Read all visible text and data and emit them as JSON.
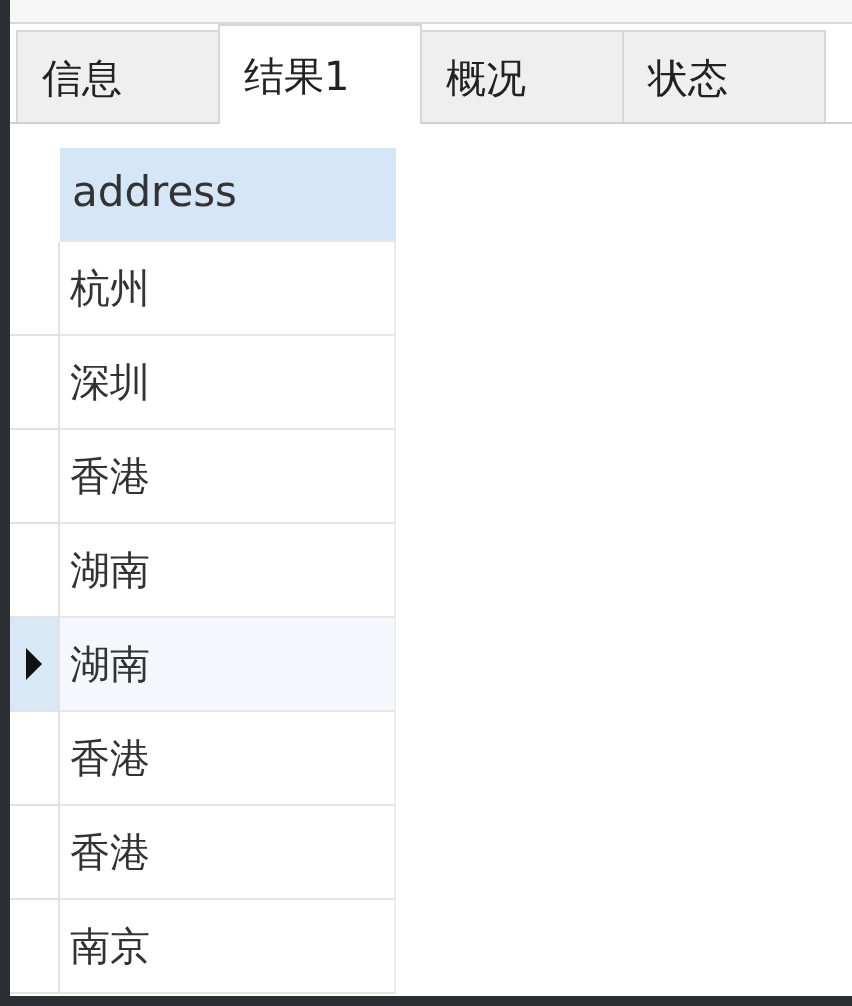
{
  "tabs": [
    {
      "label": "信息",
      "selected": false
    },
    {
      "label": "结果1",
      "selected": true
    },
    {
      "label": "概况",
      "selected": false
    },
    {
      "label": "状态",
      "selected": false
    }
  ],
  "grid": {
    "columns": [
      "address"
    ],
    "rows": [
      {
        "cells": [
          "杭州"
        ],
        "current": false
      },
      {
        "cells": [
          "深圳"
        ],
        "current": false
      },
      {
        "cells": [
          "香港"
        ],
        "current": false
      },
      {
        "cells": [
          "湖南"
        ],
        "current": false
      },
      {
        "cells": [
          "湖南"
        ],
        "current": true
      },
      {
        "cells": [
          "香港"
        ],
        "current": false
      },
      {
        "cells": [
          "香港"
        ],
        "current": false
      },
      {
        "cells": [
          "南京"
        ],
        "current": false
      }
    ]
  }
}
